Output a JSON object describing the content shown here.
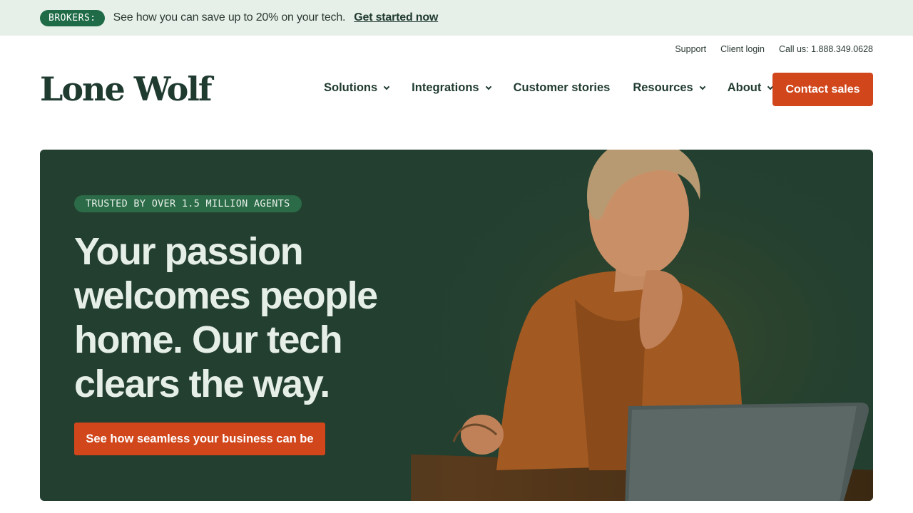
{
  "banner": {
    "badge": "BROKERS:",
    "message": "See how you can save up to 20% on your tech.",
    "cta": "Get started now"
  },
  "utility_nav": {
    "support": "Support",
    "client_login": "Client login",
    "call": "Call us: 1.888.349.0628"
  },
  "header": {
    "logo": "Lone Wolf",
    "nav": [
      {
        "label": "Solutions",
        "has_dropdown": true
      },
      {
        "label": "Integrations",
        "has_dropdown": true
      },
      {
        "label": "Customer stories",
        "has_dropdown": false
      },
      {
        "label": "Resources",
        "has_dropdown": true
      },
      {
        "label": "About",
        "has_dropdown": true
      }
    ],
    "contact_button": "Contact sales"
  },
  "hero": {
    "pill": "TRUSTED BY OVER 1.5 MILLION AGENTS",
    "title": "Your passion welcomes people home. Our tech clears the way.",
    "cta": "See how seamless your business can be"
  },
  "colors": {
    "brand_green": "#1f3a2e",
    "hero_bg": "#223f30",
    "accent_orange": "#d1461b",
    "banner_bg": "#e7efe9"
  }
}
